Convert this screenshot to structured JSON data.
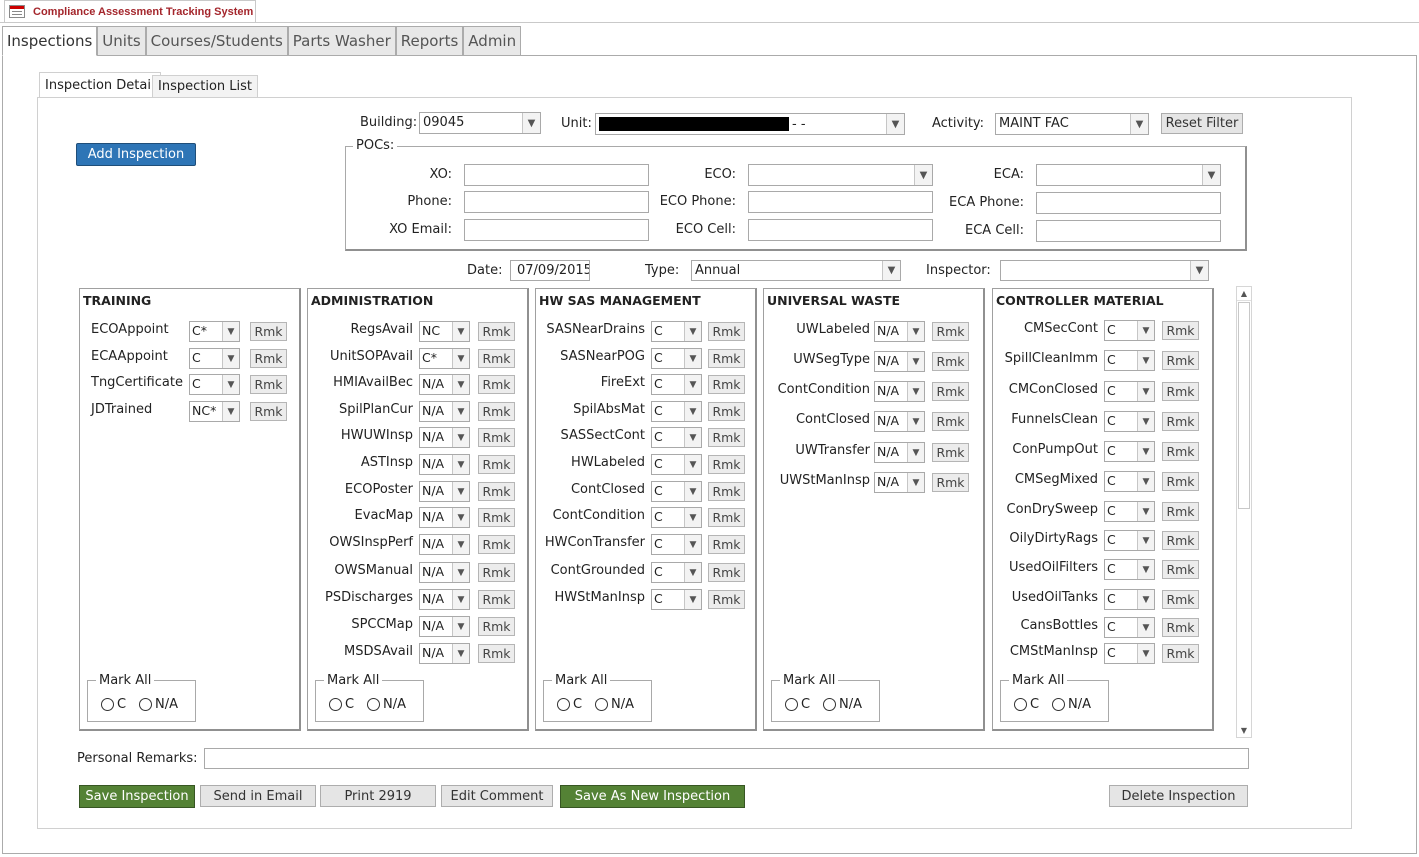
{
  "app": {
    "title": "Compliance Assessment Tracking System"
  },
  "main_tabs": [
    {
      "label": "Inspections",
      "active": true
    },
    {
      "label": "Units"
    },
    {
      "label": "Courses/Students"
    },
    {
      "label": "Parts Washer"
    },
    {
      "label": "Reports"
    },
    {
      "label": "Admin"
    }
  ],
  "sub_tabs": [
    {
      "label": "Inspection Detail",
      "active": true
    },
    {
      "label": "Inspection List"
    }
  ],
  "filters": {
    "building_label": "Building:",
    "building_value": "09045",
    "unit_label": "Unit:",
    "unit_value": "-  -",
    "activity_label": "Activity:",
    "activity_value": "MAINT FAC",
    "reset_label": "Reset Filter"
  },
  "add_inspection_label": "Add Inspection",
  "pocs": {
    "legend": "POCs:",
    "xo_label": "XO:",
    "phone_label": "Phone:",
    "xo_email_label": "XO Email:",
    "eco_label": "ECO:",
    "eco_phone_label": "ECO Phone:",
    "eco_cell_label": "ECO Cell:",
    "eca_label": "ECA:",
    "eca_phone_label": "ECA Phone:",
    "eca_cell_label": "ECA Cell:"
  },
  "meta": {
    "date_label": "Date:",
    "date_value": "07/09/2015",
    "type_label": "Type:",
    "type_value": "Annual",
    "inspector_label": "Inspector:",
    "inspector_value": ""
  },
  "rmk_label": "Rmk",
  "mark_all": {
    "legend": "Mark All",
    "c": "C",
    "na": "N/A"
  },
  "panels": [
    {
      "title": "TRAINING",
      "items": [
        {
          "label": "ECOAppoint",
          "value": "C*"
        },
        {
          "label": "ECAAppoint",
          "value": "C"
        },
        {
          "label": "TngCertificate",
          "value": "C"
        },
        {
          "label": "JDTrained",
          "value": "NC*"
        }
      ]
    },
    {
      "title": "ADMINISTRATION",
      "items": [
        {
          "label": "RegsAvail",
          "value": "NC"
        },
        {
          "label": "UnitSOPAvail",
          "value": "C*"
        },
        {
          "label": "HMIAvailBec",
          "value": "N/A"
        },
        {
          "label": "SpilPlanCur",
          "value": "N/A"
        },
        {
          "label": "HWUWInsp",
          "value": "N/A"
        },
        {
          "label": "ASTInsp",
          "value": "N/A"
        },
        {
          "label": "ECOPoster",
          "value": "N/A"
        },
        {
          "label": "EvacMap",
          "value": "N/A"
        },
        {
          "label": "OWSInspPerf",
          "value": "N/A"
        },
        {
          "label": "OWSManual",
          "value": "N/A"
        },
        {
          "label": "PSDischarges",
          "value": "N/A"
        },
        {
          "label": "SPCCMap",
          "value": "N/A"
        },
        {
          "label": "MSDSAvail",
          "value": "N/A"
        }
      ]
    },
    {
      "title": "HW SAS MANAGEMENT",
      "items": [
        {
          "label": "SASNearDrains",
          "value": "C"
        },
        {
          "label": "SASNearPOG",
          "value": "C"
        },
        {
          "label": "FireExt",
          "value": "C"
        },
        {
          "label": "SpilAbsMat",
          "value": "C"
        },
        {
          "label": "SASSectCont",
          "value": "C"
        },
        {
          "label": "HWLabeled",
          "value": "C"
        },
        {
          "label": "ContClosed",
          "value": "C"
        },
        {
          "label": "ContCondition",
          "value": "C"
        },
        {
          "label": "HWConTransfer",
          "value": "C"
        },
        {
          "label": "ContGrounded",
          "value": "C"
        },
        {
          "label": "HWStManInsp",
          "value": "C"
        }
      ]
    },
    {
      "title": "UNIVERSAL WASTE",
      "items": [
        {
          "label": "UWLabeled",
          "value": "N/A"
        },
        {
          "label": "UWSegType",
          "value": "N/A"
        },
        {
          "label": "ContCondition",
          "value": "N/A"
        },
        {
          "label": "ContClosed",
          "value": "N/A"
        },
        {
          "label": "UWTransfer",
          "value": "N/A"
        },
        {
          "label": "UWStManInsp",
          "value": "N/A"
        }
      ]
    },
    {
      "title": "CONTROLLER MATERIAL",
      "items": [
        {
          "label": "CMSecCont",
          "value": "C"
        },
        {
          "label": "SpillCleanImm",
          "value": "C"
        },
        {
          "label": "CMConClosed",
          "value": "C"
        },
        {
          "label": "FunnelsClean",
          "value": "C"
        },
        {
          "label": "ConPumpOut",
          "value": "C"
        },
        {
          "label": "CMSegMixed",
          "value": "C"
        },
        {
          "label": "ConDrySweep",
          "value": "C"
        },
        {
          "label": "OilyDirtyRags",
          "value": "C"
        },
        {
          "label": "UsedOilFilters",
          "value": "C"
        },
        {
          "label": "UsedOilTanks",
          "value": "C"
        },
        {
          "label": "CansBottles",
          "value": "C"
        },
        {
          "label": "CMStManInsp",
          "value": "C"
        }
      ]
    }
  ],
  "personal_remarks_label": "Personal Remarks:",
  "actions": {
    "save": "Save Inspection",
    "email": "Send in Email",
    "print": "Print 2919",
    "edit_comment": "Edit Comment",
    "save_new": "Save As New Inspection",
    "delete": "Delete Inspection"
  },
  "colors": {
    "blue_button": "#2e75b6",
    "green_button": "#548235",
    "title_red": "#a4262c"
  }
}
